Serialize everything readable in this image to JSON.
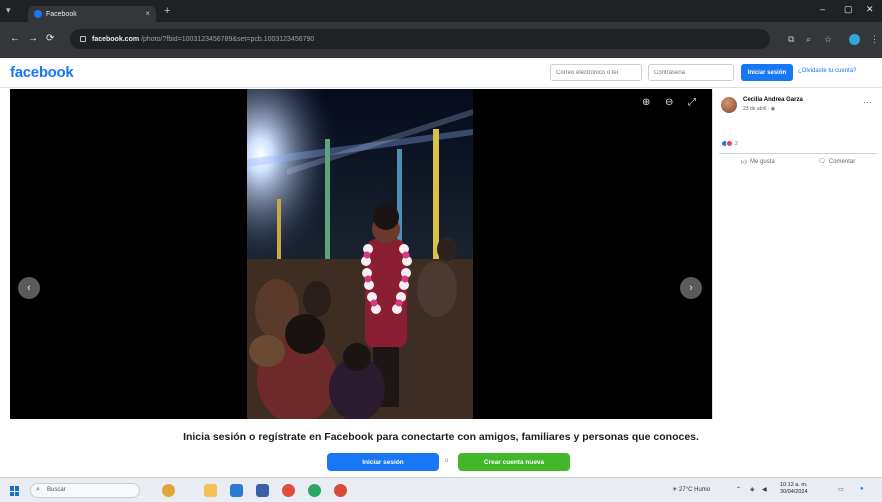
{
  "browser": {
    "tab_title": "Facebook",
    "tab_close": "×",
    "new_tab": "+",
    "url_domain": "facebook.com",
    "url_rest": "/photo/?fbid=1003123456789&set=pcb.1003123456790",
    "nav": {
      "back": "←",
      "forward": "→",
      "reload": "⟳"
    },
    "window": {
      "minimize": "–",
      "maximize": "▢",
      "close": "✕"
    }
  },
  "facebook": {
    "logo": "facebook",
    "email_placeholder": "Correo electrónico o tel",
    "password_placeholder": "Contraseña",
    "login_label": "Iniciar sesión",
    "forgot_label": "¿Olvidaste tu cuenta?"
  },
  "viewer": {
    "prev_icon": "‹",
    "next_icon": "›",
    "zoom_in_icon": "⊕",
    "zoom_out_icon": "⊖",
    "fullscreen_icon": "⤢"
  },
  "post": {
    "author": "Cecilia Andrea Garza",
    "date": "23 de abril · ",
    "more_icon": "···",
    "reaction_count": "2",
    "like_label": "Me gusta",
    "comment_label": "Comentar"
  },
  "login_bar": {
    "prompt": "Inicia sesión o regístrate en Facebook para conectarte con amigos, familiares y personas que conoces.",
    "login_label": "Iniciar sesión",
    "separator": "o",
    "signup_label": "Crear cuenta nueva"
  },
  "taskbar": {
    "search_placeholder": "Buscar",
    "weather": "27°C Humo",
    "time": "10:12 a. m.",
    "date": "30/04/2024"
  },
  "colors": {
    "facebook_blue": "#1877f2",
    "signup_green": "#42b72a"
  }
}
